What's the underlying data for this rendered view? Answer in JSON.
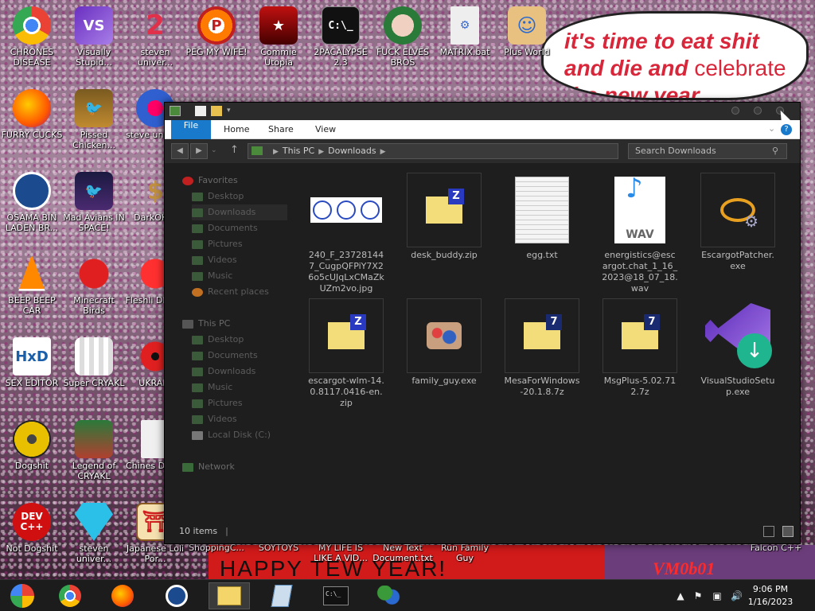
{
  "desktop": {
    "speech_bubble": {
      "line1": "it's time to eat shit",
      "line2": "and die and",
      "line2_plain": "celebrate",
      "line3": "the new year"
    },
    "banner_text": "HAPPY TEW YEAR!",
    "vm_text": "VM0b01",
    "icons": [
      {
        "label": "CHRONES DISEASE",
        "icon": "chrome-icon"
      },
      {
        "label": "Visually Stupid...",
        "icon": "visual-studio-icon"
      },
      {
        "label": "steven univer...",
        "icon": "steven-universe-icon"
      },
      {
        "label": "PEG MY WIFE!",
        "icon": "peggle-icon"
      },
      {
        "label": "Commie Utopia",
        "icon": "commie-icon"
      },
      {
        "label": "2PACALYPSE 2.3",
        "icon": "terminal-icon"
      },
      {
        "label": "FUCK ELVES BROS",
        "icon": "elf-icon"
      },
      {
        "label": "MATRIX.bat",
        "icon": "batch-file-icon"
      },
      {
        "label": "Plus World",
        "icon": "plus-world-icon"
      },
      {
        "label": "FURRY CUCKS",
        "icon": "firefox-icon"
      },
      {
        "label": "Pissed Chicken...",
        "icon": "angry-birds-seasons-icon"
      },
      {
        "label": "steve univers",
        "icon": "gem-icon"
      },
      {
        "label": "OSAMA BIN LADEN BR...",
        "icon": "obama-logo-icon"
      },
      {
        "label": "Mad Avians IN SPACE!",
        "icon": "angry-birds-space-icon"
      },
      {
        "label": "DarkOK H",
        "icon": "money-bag-icon"
      },
      {
        "label": "BEEP BEEP CAR",
        "icon": "vlc-icon"
      },
      {
        "label": "Minecraft Birds",
        "icon": "angry-birds-icon"
      },
      {
        "label": "Fleshli DELUX",
        "icon": "red-blob-icon"
      },
      {
        "label": "SEX EDITOR",
        "icon": "hxd-icon"
      },
      {
        "label": "Super CRYAKL",
        "icon": "pixel-character-icon"
      },
      {
        "label": "UKRAIN",
        "icon": "radiation-icon"
      },
      {
        "label": "Dogshit",
        "icon": "cpp-disc-icon"
      },
      {
        "label": "Legend of CRYAKL",
        "icon": "legend-character-icon"
      },
      {
        "label": "Chines Droug",
        "icon": "document-icon"
      },
      {
        "label": "Not Dogshit",
        "icon": "dev-cpp-icon"
      },
      {
        "label": "steven univer...",
        "icon": "diamond-icon"
      },
      {
        "label": "Japanese Loli Por...",
        "icon": "torii-icon"
      },
      {
        "label": "ShoppingC...",
        "icon": "shopping-icon"
      },
      {
        "label": "SOYTOYS",
        "icon": "soytoys-icon"
      },
      {
        "label": "MY LIFE IS LIKE A VID...",
        "icon": "video-icon"
      },
      {
        "label": "New Text Document.txt",
        "icon": "text-file-icon"
      },
      {
        "label": "Run Family Guy",
        "icon": "family-guy-icon"
      },
      {
        "label": "Falcon C++",
        "icon": "falcon-icon"
      }
    ]
  },
  "explorer": {
    "ribbon_tabs": {
      "file": "File",
      "home": "Home",
      "share": "Share",
      "view": "View"
    },
    "address": {
      "crumb1": "This PC",
      "crumb2": "Downloads"
    },
    "search_placeholder": "Search Downloads",
    "nav": {
      "favorites": "Favorites",
      "desktop": "Desktop",
      "downloads": "Downloads",
      "documents": "Documents",
      "pictures": "Pictures",
      "videos": "Videos",
      "music": "Music",
      "recent": "Recent places",
      "this_pc": "This PC",
      "pc_desktop": "Desktop",
      "pc_documents": "Documents",
      "pc_downloads": "Downloads",
      "pc_music": "Music",
      "pc_pictures": "Pictures",
      "pc_videos": "Videos",
      "local_disk": "Local Disk (C:)",
      "network": "Network"
    },
    "files": [
      {
        "name": "240_F_237281447_CugpQFPiY7X26o5cUJqLxCMaZkUZm2vo.jpg",
        "icon": "image-thumbnail-icon"
      },
      {
        "name": "desk_buddy.zip",
        "icon": "zip-folder-icon"
      },
      {
        "name": "egg.txt",
        "icon": "text-file-icon"
      },
      {
        "name": "energistics@escargot.chat_1_16_2023@18_07_18.wav",
        "icon": "wav-file-icon",
        "badge": "WAV"
      },
      {
        "name": "EscargotPatcher.exe",
        "icon": "escargot-patcher-icon"
      },
      {
        "name": "escargot-wlm-14.0.8117.0416-en.zip",
        "icon": "zip-folder-icon"
      },
      {
        "name": "family_guy.exe",
        "icon": "family-guy-exe-icon"
      },
      {
        "name": "MesaForWindows-20.1.8.7z",
        "icon": "7z-folder-icon"
      },
      {
        "name": "MsgPlus-5.02.712.7z",
        "icon": "7z-folder-icon"
      },
      {
        "name": "VisualStudioSetup.exe",
        "icon": "visual-studio-setup-icon"
      }
    ],
    "status": "10 items"
  },
  "taskbar": {
    "clock_time": "9:06 PM",
    "clock_date": "1/16/2023"
  }
}
